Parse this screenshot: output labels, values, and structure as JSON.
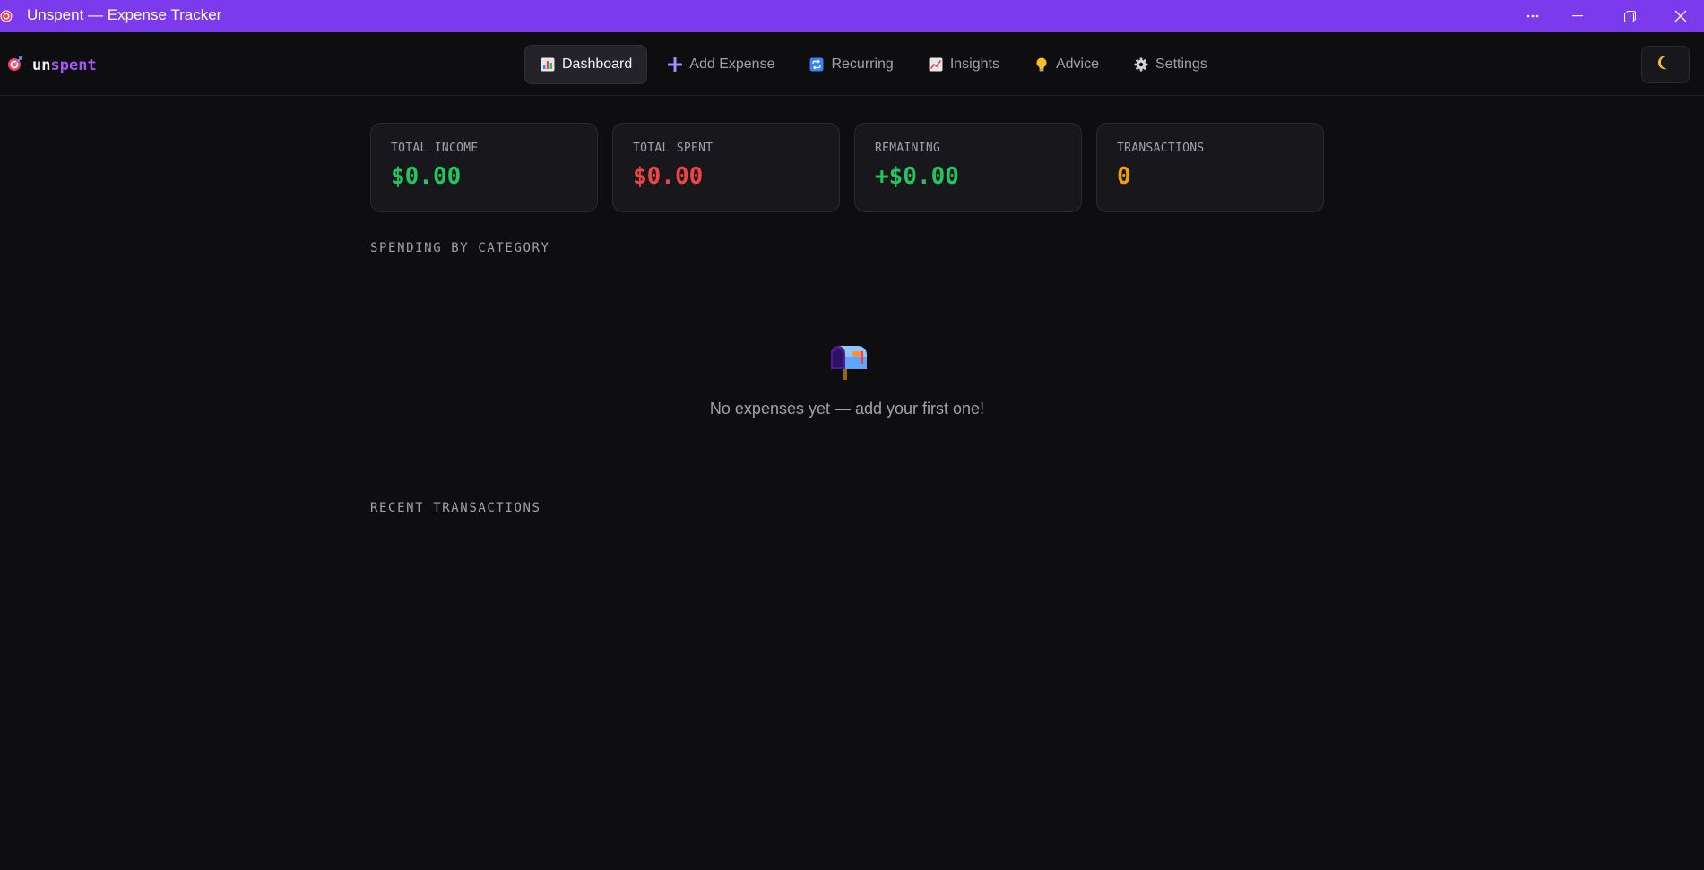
{
  "window": {
    "title": "Unspent — Expense Tracker",
    "title_bar_color": "#7c3aed",
    "controls": [
      "more-icon",
      "minimize-icon",
      "maximize-icon",
      "close-icon"
    ]
  },
  "header": {
    "brand_prefix": "un",
    "brand_suffix": "spent",
    "brand_icon": "target-icon",
    "nav": [
      {
        "label": "Dashboard",
        "icon": "bar-chart-icon",
        "active": true
      },
      {
        "label": "Add Expense",
        "icon": "plus-icon",
        "active": false
      },
      {
        "label": "Recurring",
        "icon": "repeat-icon",
        "active": false
      },
      {
        "label": "Insights",
        "icon": "trend-chart-icon",
        "active": false
      },
      {
        "label": "Advice",
        "icon": "lightbulb-icon",
        "active": false
      },
      {
        "label": "Settings",
        "icon": "gear-icon",
        "active": false
      }
    ],
    "theme_toggle_icon": "moon-icon"
  },
  "stats": [
    {
      "label": "TOTAL INCOME",
      "value": "$0.00",
      "color": "#22c55e"
    },
    {
      "label": "TOTAL SPENT",
      "value": "$0.00",
      "color": "#ef4444"
    },
    {
      "label": "REMAINING",
      "value": "+$0.00",
      "color": "#22c55e"
    },
    {
      "label": "TRANSACTIONS",
      "value": "0",
      "color": "#f59e0b"
    }
  ],
  "spending": {
    "title": "SPENDING BY CATEGORY",
    "empty_icon": "mailbox-icon",
    "empty_text": "No expenses yet — add your first one!"
  },
  "recent": {
    "title": "RECENT TRANSACTIONS"
  },
  "colors": {
    "accent": "#a855f7",
    "background": "#0e0e11",
    "card": "#18181c"
  }
}
